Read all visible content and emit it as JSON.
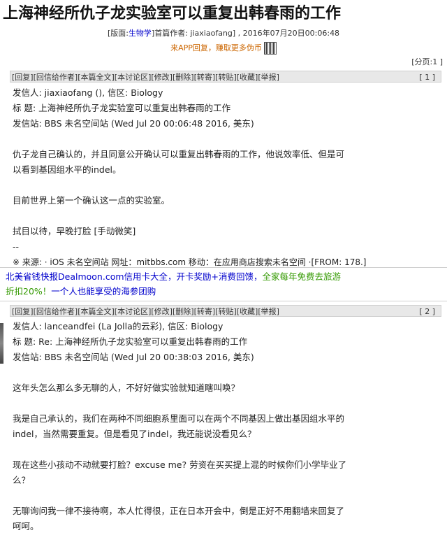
{
  "post_title": "上海神经所仇子龙实验室可以重复出韩春雨的工作",
  "meta": {
    "board_prefix": "[版面:",
    "board": "生物学",
    "board_suffix": "]首篇作者: jiaxiaofang] , 2016年07月20日00:06:48"
  },
  "app_promo": "来APP回复，赚取更多伪币",
  "page_info": "[分页:1 ]",
  "action_bar": [
    "[回复]",
    "[回信给作者]",
    "[本篇全文]",
    "[本讨论区]",
    "[修改]",
    "[删除]",
    "[转寄]",
    "[转贴]",
    "[收藏]",
    "[举报]"
  ],
  "posts": [
    {
      "number": "[ 1 ]",
      "sender": "发信人: jiaxiaofang (), 信区: Biology",
      "title": "标  题: 上海神经所仇子龙实验室可以重复出韩春雨的工作",
      "site": "发信站: BBS 未名空间站 (Wed Jul 20 00:06:48 2016, 美东)",
      "body": [
        "仇子龙自己确认的，并且同意公开确认可以重复出韩春雨的工作，他说效率低、但是可",
        "以看到基因组水平的indel。"
      ],
      "body2": "目前世界上第一个确认这一点的实验室。",
      "body3": "拭目以待，早晚打脸 [手动微笑]",
      "dashes": "--",
      "source": "※ 来源: · iOS 未名空间站 网址：mitbbs.com 移动：在应用商店搜索未名空间 ·[FROM: 178.]"
    },
    {
      "number": "[ 2 ]",
      "sender": "发信人: lanceandfei (La Jolla的云彩), 信区: Biology",
      "title": "标  题: Re: 上海神经所仇子龙实验室可以重复出韩春雨的工作",
      "site": "发信站: BBS 未名空间站 (Wed Jul 20 00:38:03 2016, 美东)",
      "p1": "这年头怎么那么多无聊的人，不好好做实验就知道瞎叫唤？",
      "p2a": "我是自己承认的，我们在两种不同细胞系里面可以在两个不同基因上做出基因组水平的",
      "p2b": "indel，当然需要重复。但是看见了indel，我还能说没看见么？",
      "p3a": "现在这些小孩动不动就要打脸？excuse me? 劳资在买买提上混的时候你们小学毕业了",
      "p3b": "么？",
      "p4a": "无聊询问我一律不接待啊，本人忙得很，正在日本开会中，倒是正好不用翻墙来回复了",
      "p4b": "呵呵。"
    }
  ],
  "ad": {
    "line1_blue": "北美省钱快报Dealmoon.com信用卡大全，开卡奖励+消费回馈，",
    "line1_green": "全家每年免费去旅游",
    "line2_green": "折扣20%！",
    "line2_blue": "一个人也能享受的海参团购"
  }
}
